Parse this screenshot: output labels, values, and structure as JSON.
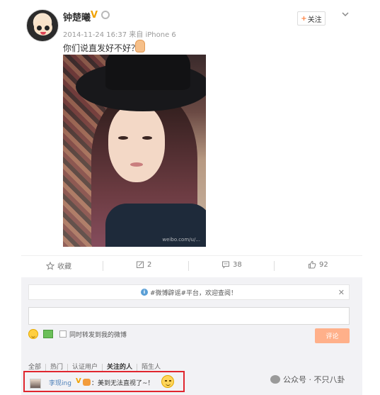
{
  "post": {
    "username": "钟楚曦",
    "verified_mark": "V",
    "meta": "2014-11-24 16:37 来自 iPhone 6",
    "text": "你们说直发好不好？",
    "follow_plus": "+",
    "follow_label": "关注",
    "photo_watermark": "weibo.com/u/..."
  },
  "actions": {
    "favorite_label": "收藏",
    "repost_count": "2",
    "comment_count": "38",
    "like_count": "92"
  },
  "comments": {
    "notice": "#微博辟谣#平台，欢迎查阅！",
    "repost_label": "同时转发到我的微博",
    "submit_label": "评论",
    "filters": [
      "全部",
      "热门",
      "认证用户",
      "关注的人",
      "陌生人"
    ],
    "active_filter": "关注的人",
    "highlighted": {
      "user": "李现ing",
      "verified_mark": "V",
      "text": "：美到无法直视了~！"
    }
  },
  "watermark": {
    "text": "公众号 · 不只八卦"
  },
  "colors": {
    "accent": "#ff8140",
    "link": "#4a7eb8",
    "highlight_border": "#e0262e",
    "verified": "#f0a202"
  }
}
